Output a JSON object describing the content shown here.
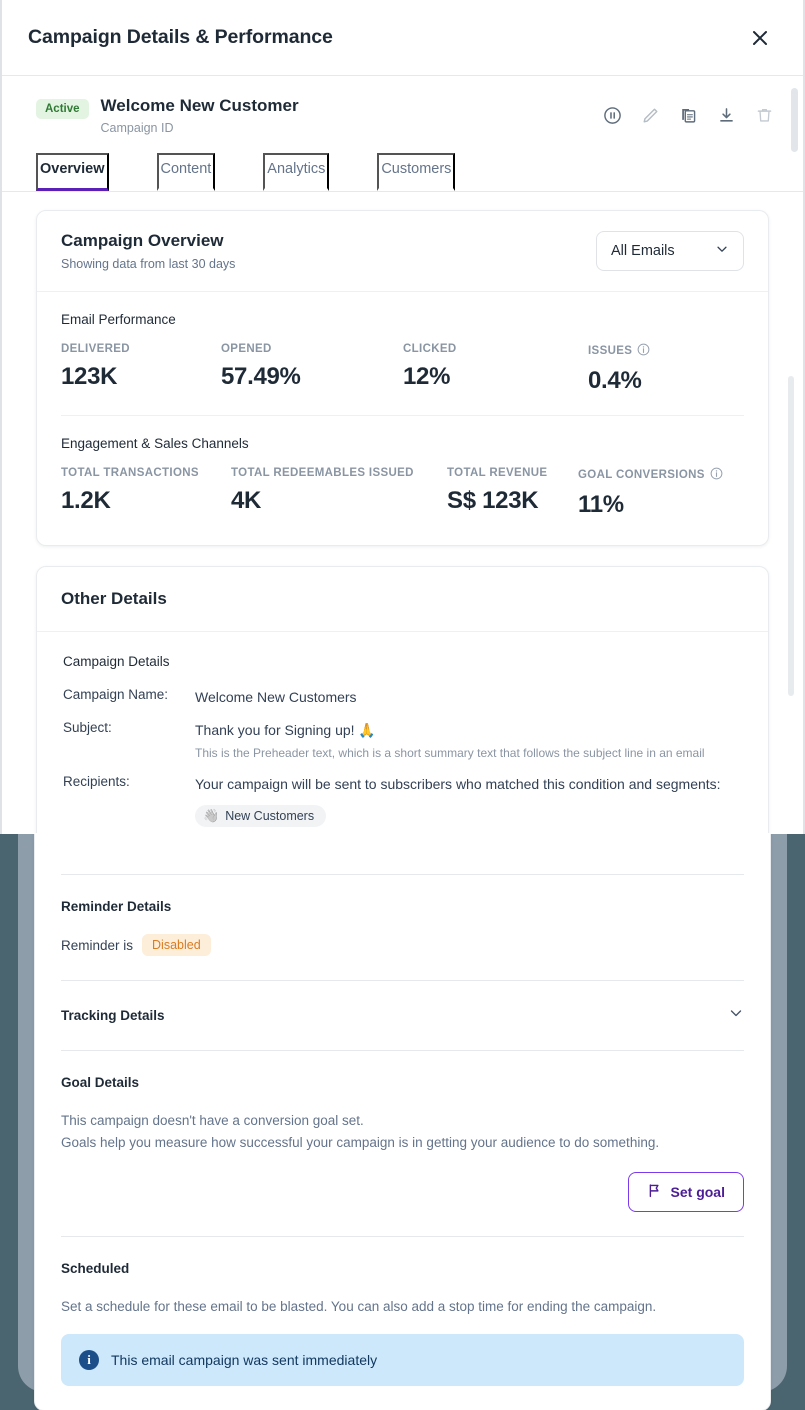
{
  "modal": {
    "title": "Campaign Details & Performance",
    "close_label": "✕"
  },
  "campaign": {
    "status": "Active",
    "name": "Welcome New Customer",
    "id_label": "Campaign ID",
    "actions": [
      {
        "name": "pause-icon",
        "label": "Pause"
      },
      {
        "name": "edit-icon",
        "label": "Edit"
      },
      {
        "name": "duplicate-icon",
        "label": "Duplicate"
      },
      {
        "name": "download-icon",
        "label": "Download"
      },
      {
        "name": "delete-icon",
        "label": "Delete"
      }
    ]
  },
  "tabs": [
    {
      "label": "Overview",
      "active": true
    },
    {
      "label": "Content",
      "active": false
    },
    {
      "label": "Analytics",
      "active": false
    },
    {
      "label": "Customers",
      "active": false
    }
  ],
  "overview": {
    "title": "Campaign Overview",
    "subtitle": "Showing data from last 30 days",
    "filter": {
      "selected": "All Emails",
      "chevron": "chevron-down-icon"
    },
    "email_performance": {
      "label": "Email Performance",
      "metrics": [
        {
          "label": "DELIVERED",
          "value": "123K",
          "info": false
        },
        {
          "label": "OPENED",
          "value": "57.49%",
          "info": false
        },
        {
          "label": "CLICKED",
          "value": "12%",
          "info": false
        },
        {
          "label": "ISSUES",
          "value": "0.4%",
          "info": true
        }
      ]
    },
    "engagement": {
      "label": "Engagement & Sales Channels",
      "metrics": [
        {
          "label": "TOTAL TRANSACTIONS",
          "value": "1.2K",
          "info": false
        },
        {
          "label": "TOTAL REDEEMABLES ISSUED",
          "value": "4K",
          "info": false
        },
        {
          "label": "TOTAL REVENUE",
          "value": "S$ 123K",
          "info": false
        },
        {
          "label": "GOAL CONVERSIONS",
          "value": "11%",
          "info": true
        }
      ]
    }
  },
  "other_details": {
    "title": "Other Details",
    "campaign_details": {
      "heading": "Campaign Details",
      "rows": [
        {
          "key": "Campaign Name:",
          "value": "Welcome New Customers"
        },
        {
          "key": "Subject:",
          "value": "Thank you for Signing up! 🙏",
          "sub": "This is the Preheader text, which is a short summary text that follows the subject line in an email"
        },
        {
          "key": "Recipients:",
          "value": "Your campaign will be sent to subscribers who matched this condition and segments:"
        }
      ],
      "segment_chip": {
        "emoji": "👋",
        "label": "New Customers"
      }
    },
    "reminder": {
      "heading": "Reminder Details",
      "prefix": "Reminder is",
      "state": "Disabled"
    },
    "tracking": {
      "heading": "Tracking Details",
      "chevron": "chevron-down-icon"
    },
    "goal": {
      "heading": "Goal Details",
      "line1": "This campaign doesn't have a conversion goal set.",
      "line2": "Goals help you measure how successful your campaign is in getting your audience to do something.",
      "button": "Set goal",
      "button_icon": "flag-icon"
    },
    "scheduled": {
      "heading": "Scheduled",
      "description": "Set a schedule for these email to be blasted. You can also add a stop time for ending the campaign.",
      "banner": "This email campaign was sent immediately",
      "banner_icon": "info-icon"
    }
  },
  "colors": {
    "accent_purple": "#5b21b6",
    "status_green_bg": "#e3f4e3",
    "status_green_text": "#2f7a32",
    "warn_bg": "#fdeeda",
    "warn_text": "#d97b22",
    "info_bg": "#cde8fb",
    "info_text": "#10365e",
    "backdrop": "#4b6570"
  }
}
